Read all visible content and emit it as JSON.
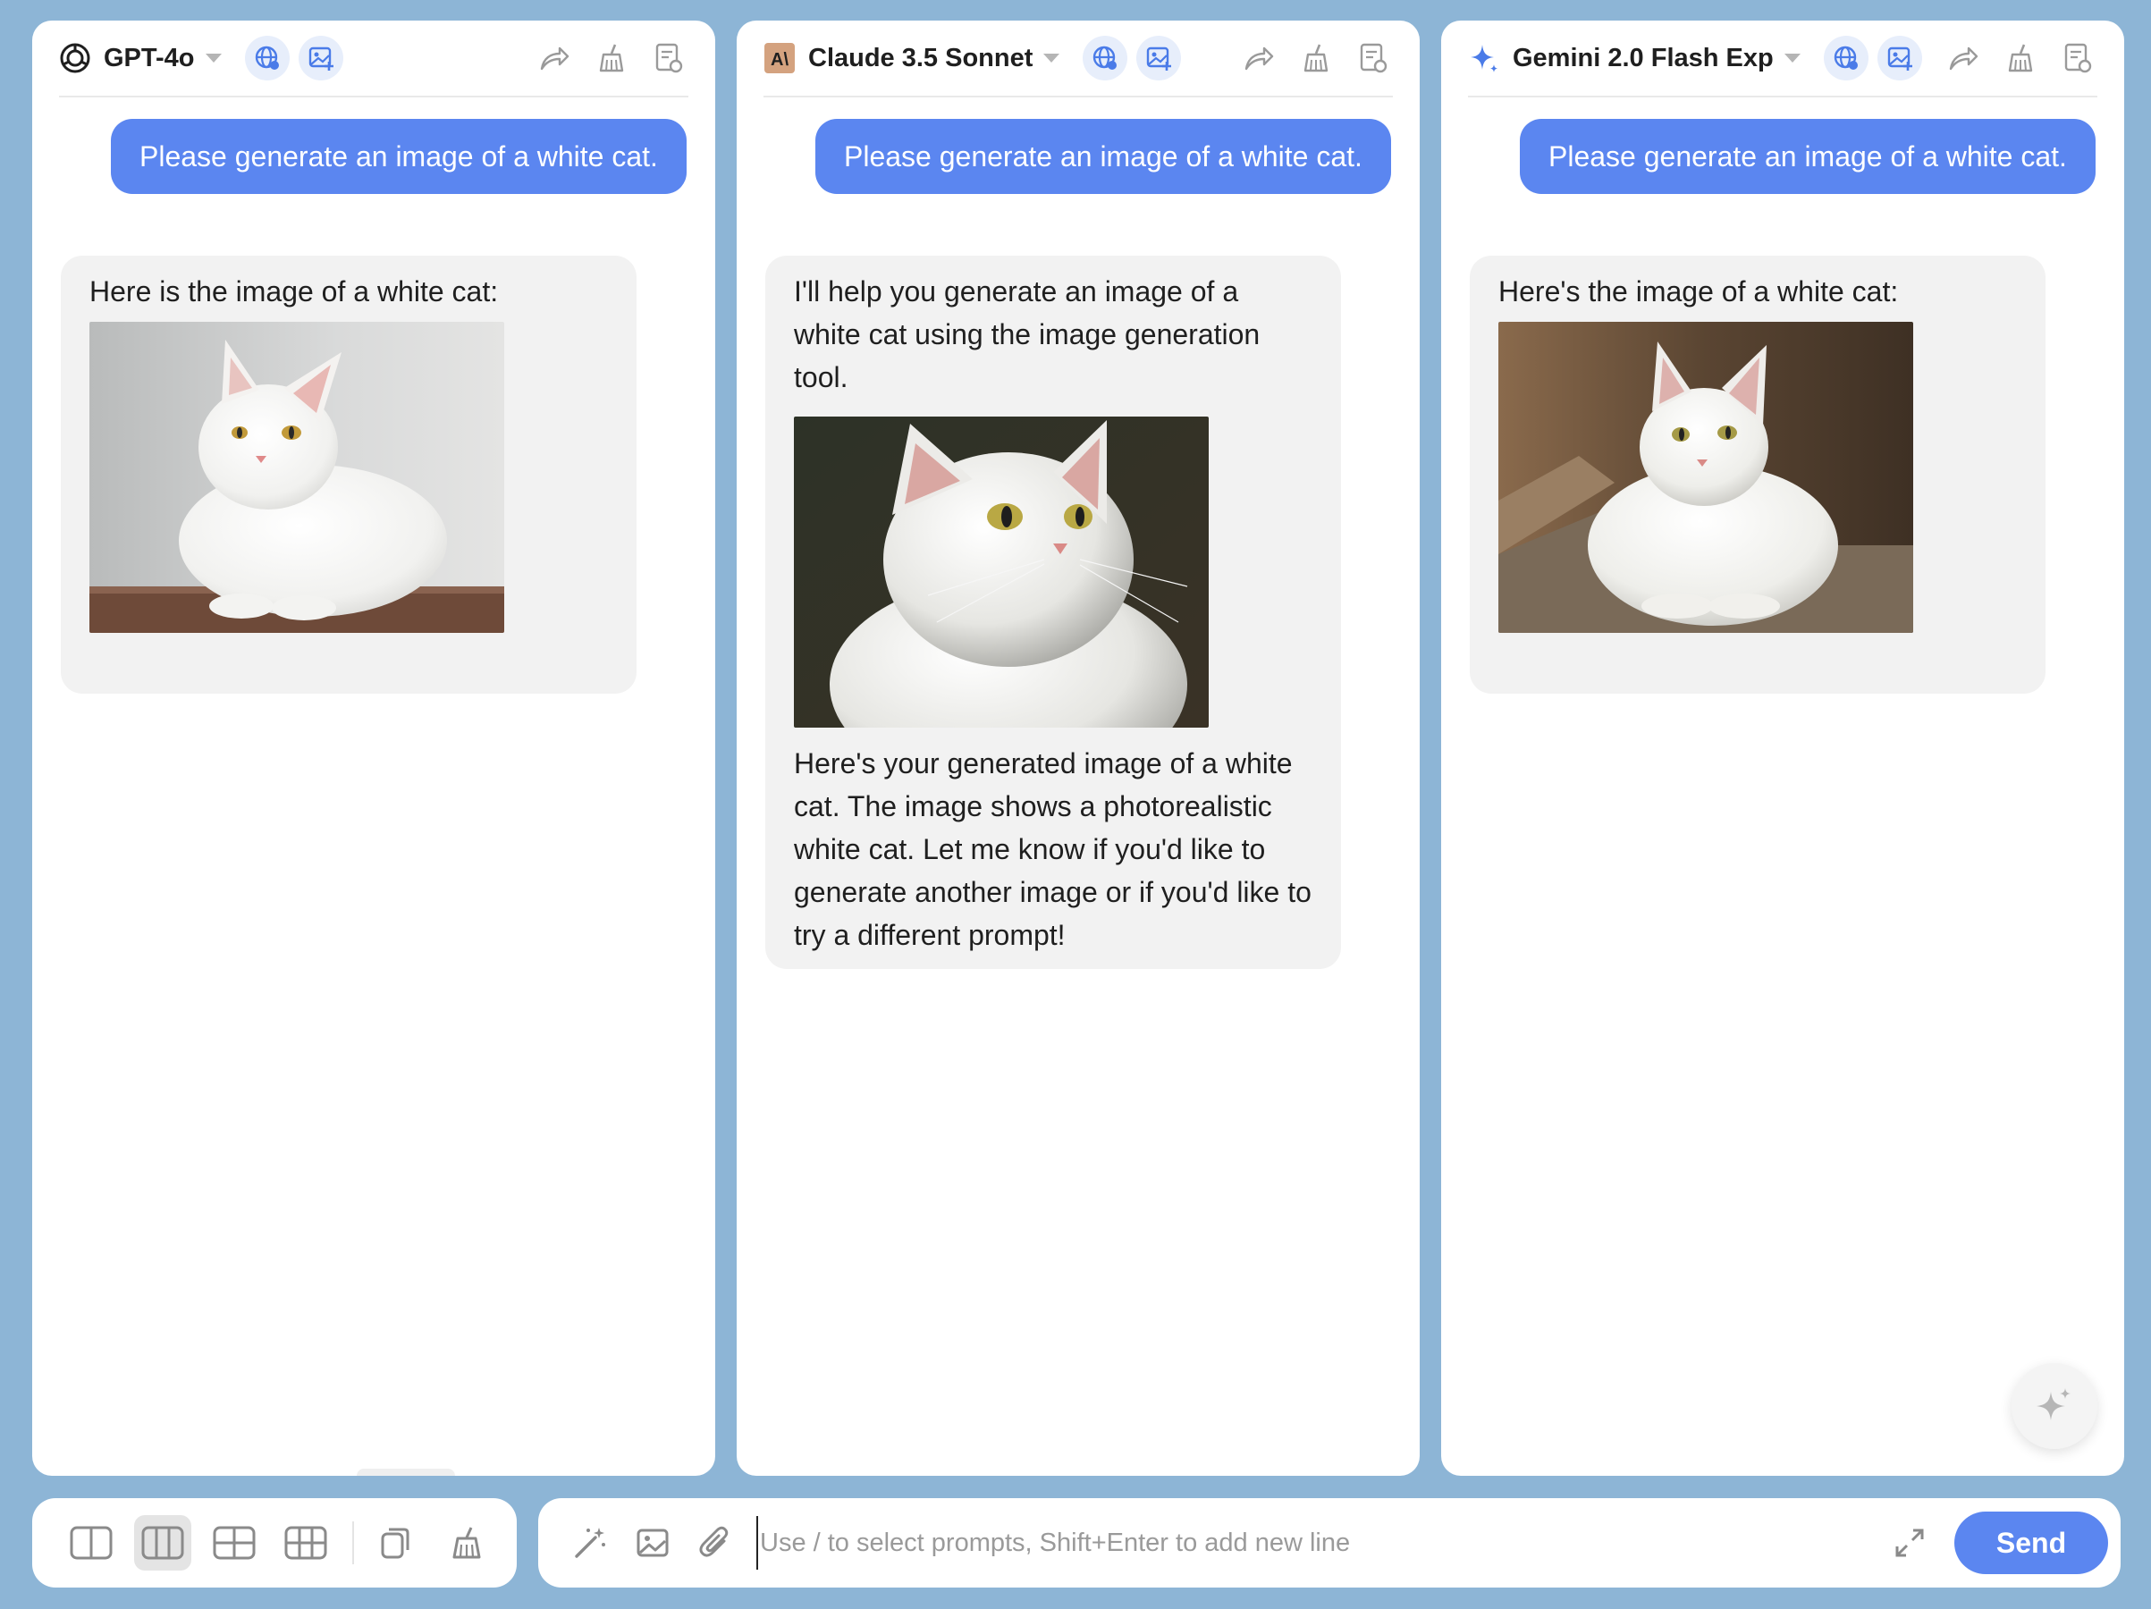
{
  "accent_color": "#5b86f0",
  "background_color": "#8db5d6",
  "panels": [
    {
      "model_name": "GPT-4o",
      "logo_icon": "openai-logo-icon",
      "user_message": "Please generate an image of a white cat.",
      "bot_message_before": "Here is the image of a white cat:",
      "bot_message_after": "",
      "image_alt": "white cat lying on a table, light background"
    },
    {
      "model_name": "Claude 3.5 Sonnet",
      "logo_icon": "anthropic-logo-icon",
      "user_message": "Please generate an image of a white cat.",
      "bot_message_before": "I'll help you generate an image of a white cat using the image generation tool.",
      "bot_message_after": "Here's your generated image of a white cat. The image shows a photorealistic white cat. Let me know if you'd like to generate another image or if you'd like to try a different prompt!",
      "image_alt": "close-up white cat looking up, dark background"
    },
    {
      "model_name": "Gemini 2.0 Flash Exp",
      "logo_icon": "gemini-sparkle-icon",
      "user_message": "Please generate an image of a white cat.",
      "bot_message_before": "Here's the image of a white cat:",
      "bot_message_after": "",
      "image_alt": "white cat sitting on stone, brown background"
    }
  ],
  "input": {
    "placeholder": "Use / to select prompts, Shift+Enter to add new line",
    "value": "",
    "send_label": "Send"
  }
}
